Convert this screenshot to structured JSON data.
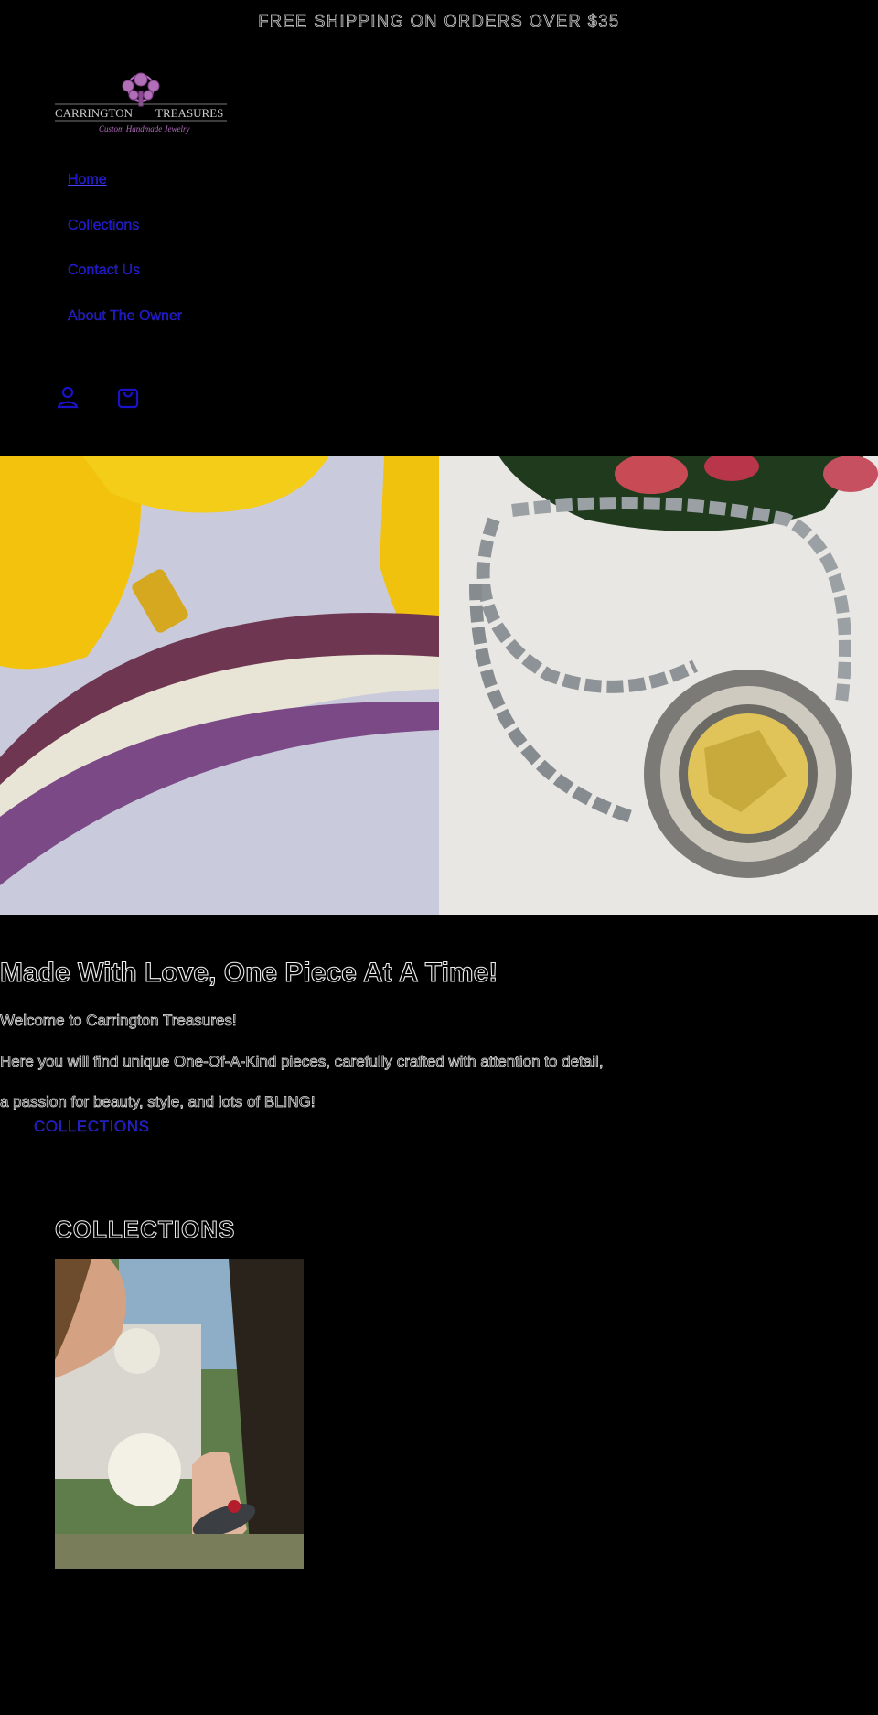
{
  "announcement": "FREE SHIPPING ON ORDERS OVER $35",
  "logo": {
    "line1_left": "CARRINGTON",
    "line1_right": "TREASURES",
    "tagline": "Custom Handmade Jewelry"
  },
  "nav": {
    "items": [
      "Home",
      "Collections",
      "Contact Us",
      "About The Owner"
    ]
  },
  "header_icons": [
    "account-icon",
    "cart-icon"
  ],
  "hero": {
    "heading": "Made With Love, One Piece At A Time!",
    "paragraphs": [
      "Welcome to Carrington Treasures!",
      "Here you will find unique One-Of-A-Kind pieces, carefully crafted with attention to detail,",
      "a passion for beauty, style, and lots of BLING!"
    ],
    "cta_label": "COLLECTIONS"
  },
  "collections": {
    "title": "COLLECTIONS"
  },
  "colors": {
    "link": "#1a12c9",
    "background": "#000000"
  }
}
